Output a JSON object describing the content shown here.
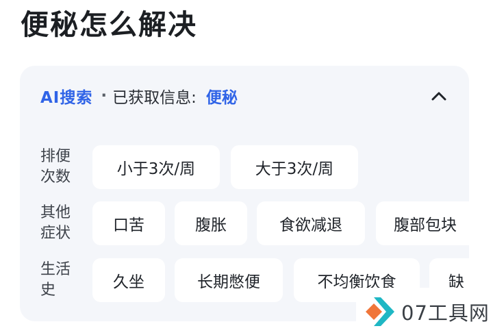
{
  "page": {
    "title": "便秘怎么解决"
  },
  "card": {
    "ai_label": "AI搜索",
    "separator": "·",
    "info_text": "已获取信息:",
    "keyword": "便秘",
    "collapse_icon": "chevron-up-icon"
  },
  "rows": [
    {
      "label": "排便次数",
      "chips": [
        "小于3次/周",
        "大于3次/周"
      ]
    },
    {
      "label": "其他症状",
      "chips": [
        "口苦",
        "腹胀",
        "食欲减退",
        "腹部包块"
      ]
    },
    {
      "label": "生活史",
      "chips": [
        "久坐",
        "长期憋便",
        "不均衡饮食",
        "缺"
      ]
    }
  ],
  "watermark": {
    "text": "07工具网"
  },
  "colors": {
    "accent": "#3064e7",
    "card_bg": "#f4f6fa",
    "logo_orange": "#f0763a",
    "logo_teal": "#1fb7c4"
  }
}
